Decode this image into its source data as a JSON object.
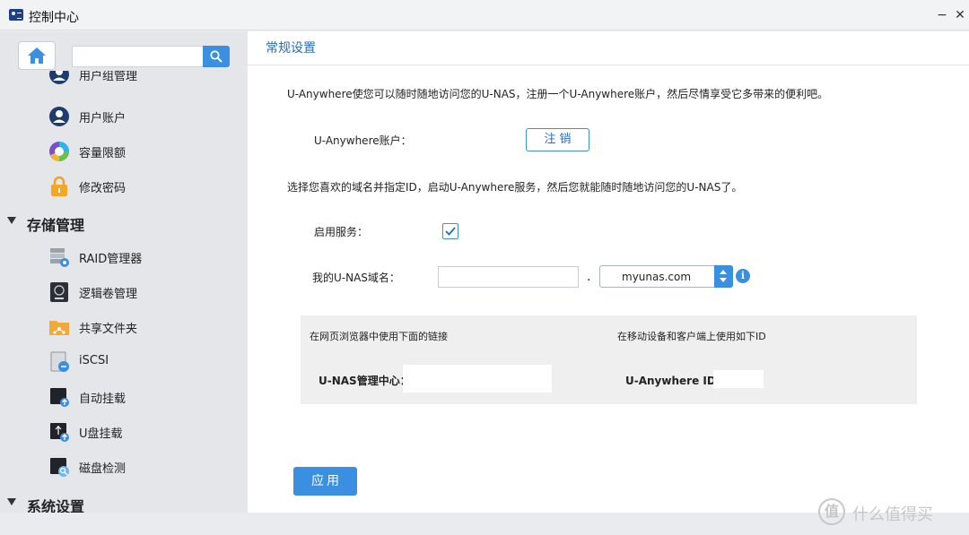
{
  "window": {
    "title": "控制中心",
    "minimize_label": "−",
    "close_label": "✕"
  },
  "sidebar": {
    "search_placeholder": "",
    "partial_item_label": "用户组管理",
    "groups": [
      {
        "label": "存储管理"
      },
      {
        "label": "系统设置"
      }
    ],
    "account_items": [
      {
        "label": "用户账户",
        "icon": "user-account-icon"
      },
      {
        "label": "容量限额",
        "icon": "quota-icon"
      },
      {
        "label": "修改密码",
        "icon": "lock-icon"
      }
    ],
    "storage_items": [
      {
        "label": "RAID管理器",
        "icon": "raid-icon"
      },
      {
        "label": "逻辑卷管理",
        "icon": "lvm-icon"
      },
      {
        "label": "共享文件夹",
        "icon": "shared-folder-icon"
      },
      {
        "label": "iSCSI",
        "icon": "iscsi-icon"
      },
      {
        "label": "自动挂载",
        "icon": "auto-mount-icon"
      },
      {
        "label": "U盘挂载",
        "icon": "usb-mount-icon"
      },
      {
        "label": "磁盘检测",
        "icon": "disk-check-icon"
      }
    ]
  },
  "main": {
    "tab_title": "常规设置",
    "description1": "U-Anywhere使您可以随时随地访问您的U-NAS，注册一个U-Anywhere账户，然后尽情享受它多带来的便利吧。",
    "account_label": "U-Anywhere账户：",
    "logout_button": "注销",
    "description2": "选择您喜欢的域名并指定ID，启动U-Anywhere服务，然后您就能随时随地访问您的U-NAS了。",
    "enable_label": "启用服务：",
    "enable_checked": true,
    "domain_label": "我的U-NAS域名：",
    "domain_value": "",
    "dot": ".",
    "domain_suffix": "myunas.com",
    "info_icon_glyph": "i",
    "panel": {
      "browser_heading": "在网页浏览器中使用下面的链接",
      "mobile_heading": "在移动设备和客户端上使用如下ID",
      "mgmt_label": "U-NAS管理中心：",
      "uid_label": "U-Anywhere ID："
    },
    "apply_button": "应用"
  },
  "watermark": {
    "badge": "值",
    "text": "什么值得买"
  },
  "colors": {
    "accent": "#3a8fe0",
    "link_text": "#2b6cb8",
    "sidebar_bg": "#e4e6ea",
    "panel_bg": "#efeff0"
  }
}
